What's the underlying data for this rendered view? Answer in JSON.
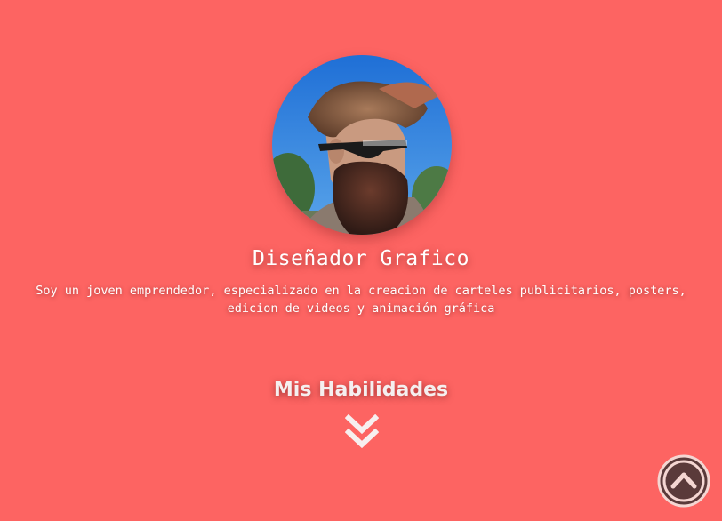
{
  "profile": {
    "avatar_alt": "Foto de perfil",
    "title": "Diseñador Grafico",
    "description": "Soy un joven emprendedor, especializado en la creacion de carteles publicitarios, posters, edicion de videos y animación gráfica"
  },
  "skills": {
    "heading": "Mis Habilidades",
    "scroll_icon": "double-chevron-down-icon"
  },
  "scroll_top": {
    "icon": "chevron-up-circle-icon"
  },
  "colors": {
    "background": "#fd6462",
    "text": "#ffffff",
    "scroll_button_fill": "#5a3a3a",
    "scroll_button_ring": "#f4d6d2"
  }
}
